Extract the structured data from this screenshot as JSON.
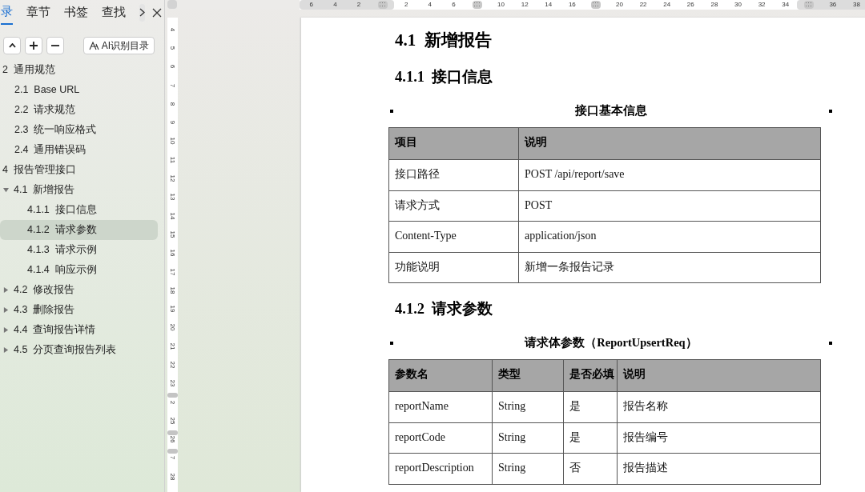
{
  "sidebar": {
    "tabs": [
      {
        "label": "录",
        "selected": true
      },
      {
        "label": "章节",
        "selected": false
      },
      {
        "label": "书签",
        "selected": false
      },
      {
        "label": "查找",
        "selected": false
      }
    ],
    "toolbar": {
      "ai_button": "AI识别目录"
    },
    "outline": [
      {
        "label": "2  通用规范",
        "selected": false,
        "children": [
          {
            "label": "2.1  Base URL",
            "selected": false
          },
          {
            "label": "2.2  请求规范",
            "selected": false
          },
          {
            "label": "2.3  统一响应格式",
            "selected": false
          },
          {
            "label": "2.4  通用错误码",
            "selected": false
          }
        ]
      },
      {
        "label": "4  报告管理接口",
        "selected": false,
        "children": [
          {
            "label": "4.1  新增报告",
            "selected": false,
            "expanded": true,
            "children": [
              {
                "label": "4.1.1  接口信息",
                "selected": false
              },
              {
                "label": "4.1.2  请求参数",
                "selected": true
              },
              {
                "label": "4.1.3  请求示例",
                "selected": false
              },
              {
                "label": "4.1.4  响应示例",
                "selected": false
              }
            ]
          },
          {
            "label": "4.2  修改报告",
            "selected": false,
            "expanded": false
          },
          {
            "label": "4.3  删除报告",
            "selected": false,
            "expanded": false
          },
          {
            "label": "4.4  查询报告详情",
            "selected": false,
            "expanded": false
          },
          {
            "label": "4.5  分页查询报告列表",
            "selected": false,
            "expanded": false
          }
        ]
      }
    ]
  },
  "vertical_ruler": [
    {
      "kind": "number",
      "label": "4"
    },
    {
      "kind": "number",
      "label": "5"
    },
    {
      "kind": "number",
      "label": "6"
    },
    {
      "kind": "number",
      "label": "7"
    },
    {
      "kind": "number",
      "label": "8"
    },
    {
      "kind": "number",
      "label": "9"
    },
    {
      "kind": "number",
      "label": "10"
    },
    {
      "kind": "number",
      "label": "11"
    },
    {
      "kind": "number",
      "label": "12"
    },
    {
      "kind": "number",
      "label": "13"
    },
    {
      "kind": "number",
      "label": "14"
    },
    {
      "kind": "number",
      "label": "15"
    },
    {
      "kind": "number",
      "label": "16"
    },
    {
      "kind": "number",
      "label": "17"
    },
    {
      "kind": "number",
      "label": "18"
    },
    {
      "kind": "number",
      "label": "19"
    },
    {
      "kind": "number",
      "label": "20"
    },
    {
      "kind": "number",
      "label": "21"
    },
    {
      "kind": "number",
      "label": "22"
    },
    {
      "kind": "number",
      "label": "23"
    },
    {
      "kind": "grip",
      "label": "2"
    },
    {
      "kind": "number",
      "label": "25"
    },
    {
      "kind": "grip",
      "label": "26"
    },
    {
      "kind": "grip",
      "label": "7"
    },
    {
      "kind": "number",
      "label": "28"
    }
  ],
  "horizontal_ruler": {
    "left_margin": [
      {
        "kind": "number",
        "label": "6"
      },
      {
        "kind": "number",
        "label": "4"
      },
      {
        "kind": "number",
        "label": "2"
      },
      {
        "kind": "grip"
      }
    ],
    "body": [
      {
        "kind": "number",
        "label": "2"
      },
      {
        "kind": "number",
        "label": "4"
      },
      {
        "kind": "number",
        "label": "6"
      },
      {
        "kind": "grip"
      },
      {
        "kind": "number",
        "label": "10"
      },
      {
        "kind": "number",
        "label": "12"
      },
      {
        "kind": "number",
        "label": "14"
      },
      {
        "kind": "number",
        "label": "16"
      },
      {
        "kind": "grip"
      },
      {
        "kind": "number",
        "label": "20"
      },
      {
        "kind": "number",
        "label": "22"
      },
      {
        "kind": "number",
        "label": "24"
      },
      {
        "kind": "number",
        "label": "26"
      },
      {
        "kind": "number",
        "label": "28"
      },
      {
        "kind": "number",
        "label": "30"
      },
      {
        "kind": "number",
        "label": "32"
      },
      {
        "kind": "number",
        "label": "34"
      }
    ],
    "right_margin": [
      {
        "kind": "grip"
      },
      {
        "kind": "number",
        "label": "36"
      },
      {
        "kind": "number",
        "label": "38"
      }
    ]
  },
  "document": [
    {
      "kind": "heading1",
      "text": "4.1  新增报告"
    },
    {
      "kind": "heading2",
      "text": "4.1.1  接口信息"
    },
    {
      "kind": "table",
      "caption": "接口基本信息",
      "columns": [
        "项目",
        "说明"
      ],
      "rows": [
        [
          "接口路径",
          "POST /api/report/save"
        ],
        [
          "请求方式",
          "POST"
        ],
        [
          "Content-Type",
          "application/json"
        ],
        [
          "功能说明",
          "新增一条报告记录"
        ]
      ]
    },
    {
      "kind": "heading2",
      "text": "4.1.2  请求参数"
    },
    {
      "kind": "table",
      "caption": "请求体参数（ReportUpsertReq）",
      "columns": [
        "参数名",
        "类型",
        "是否必填",
        "说明"
      ],
      "rows": [
        [
          "reportName",
          "String",
          "是",
          "报告名称"
        ],
        [
          "reportCode",
          "String",
          "是",
          "报告编号"
        ],
        [
          "reportDescription",
          "String",
          "否",
          "报告描述"
        ]
      ]
    }
  ]
}
